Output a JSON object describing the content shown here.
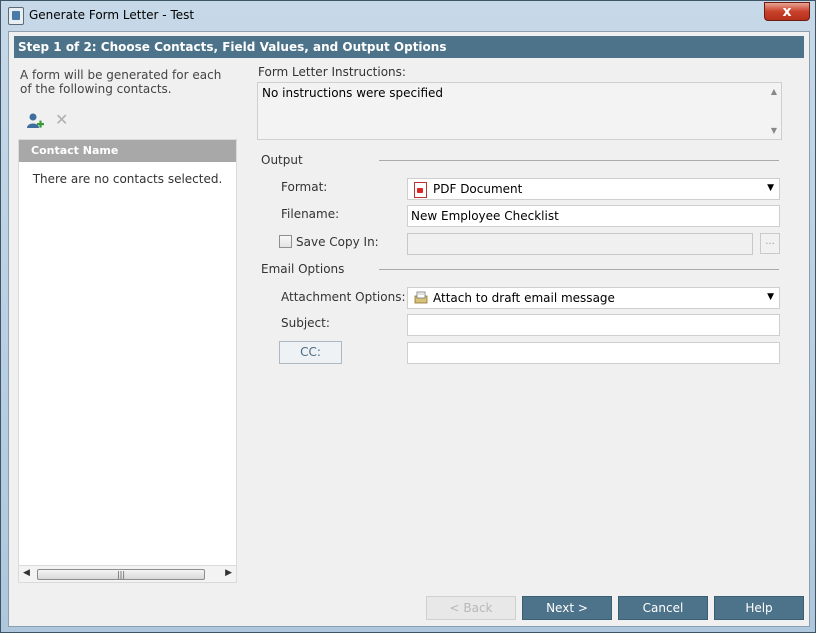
{
  "window": {
    "title": "Generate Form Letter - Test",
    "close_label": "x"
  },
  "step": {
    "title": "Step 1 of 2:  Choose Contacts, Field Values, and Output Options"
  },
  "contacts": {
    "description": "A form will be generated for each of the following contacts.",
    "column_header": "Contact Name",
    "empty_text": "There are no contacts selected.",
    "add_icon": "add-contact-icon",
    "remove_icon": "remove-icon"
  },
  "instructions": {
    "label": "Form Letter Instructions:",
    "text": "No instructions were specified"
  },
  "output": {
    "section_label": "Output",
    "format_label": "Format:",
    "format_value": "PDF Document",
    "filename_label": "Filename:",
    "filename_value": "New Employee Checklist",
    "save_copy_label": "Save Copy In:",
    "save_copy_value": "",
    "save_copy_checked": false,
    "browse_label": "..."
  },
  "email": {
    "section_label": "Email Options",
    "attachment_label": "Attachment Options:",
    "attachment_value": "Attach to draft email message",
    "subject_label": "Subject:",
    "subject_value": "",
    "cc_label": "CC:",
    "cc_value": ""
  },
  "buttons": {
    "back": "<  Back",
    "next": "Next >",
    "cancel": "Cancel",
    "help": "Help"
  },
  "colors": {
    "accent": "#4c7389",
    "close_red": "#c9412b"
  }
}
